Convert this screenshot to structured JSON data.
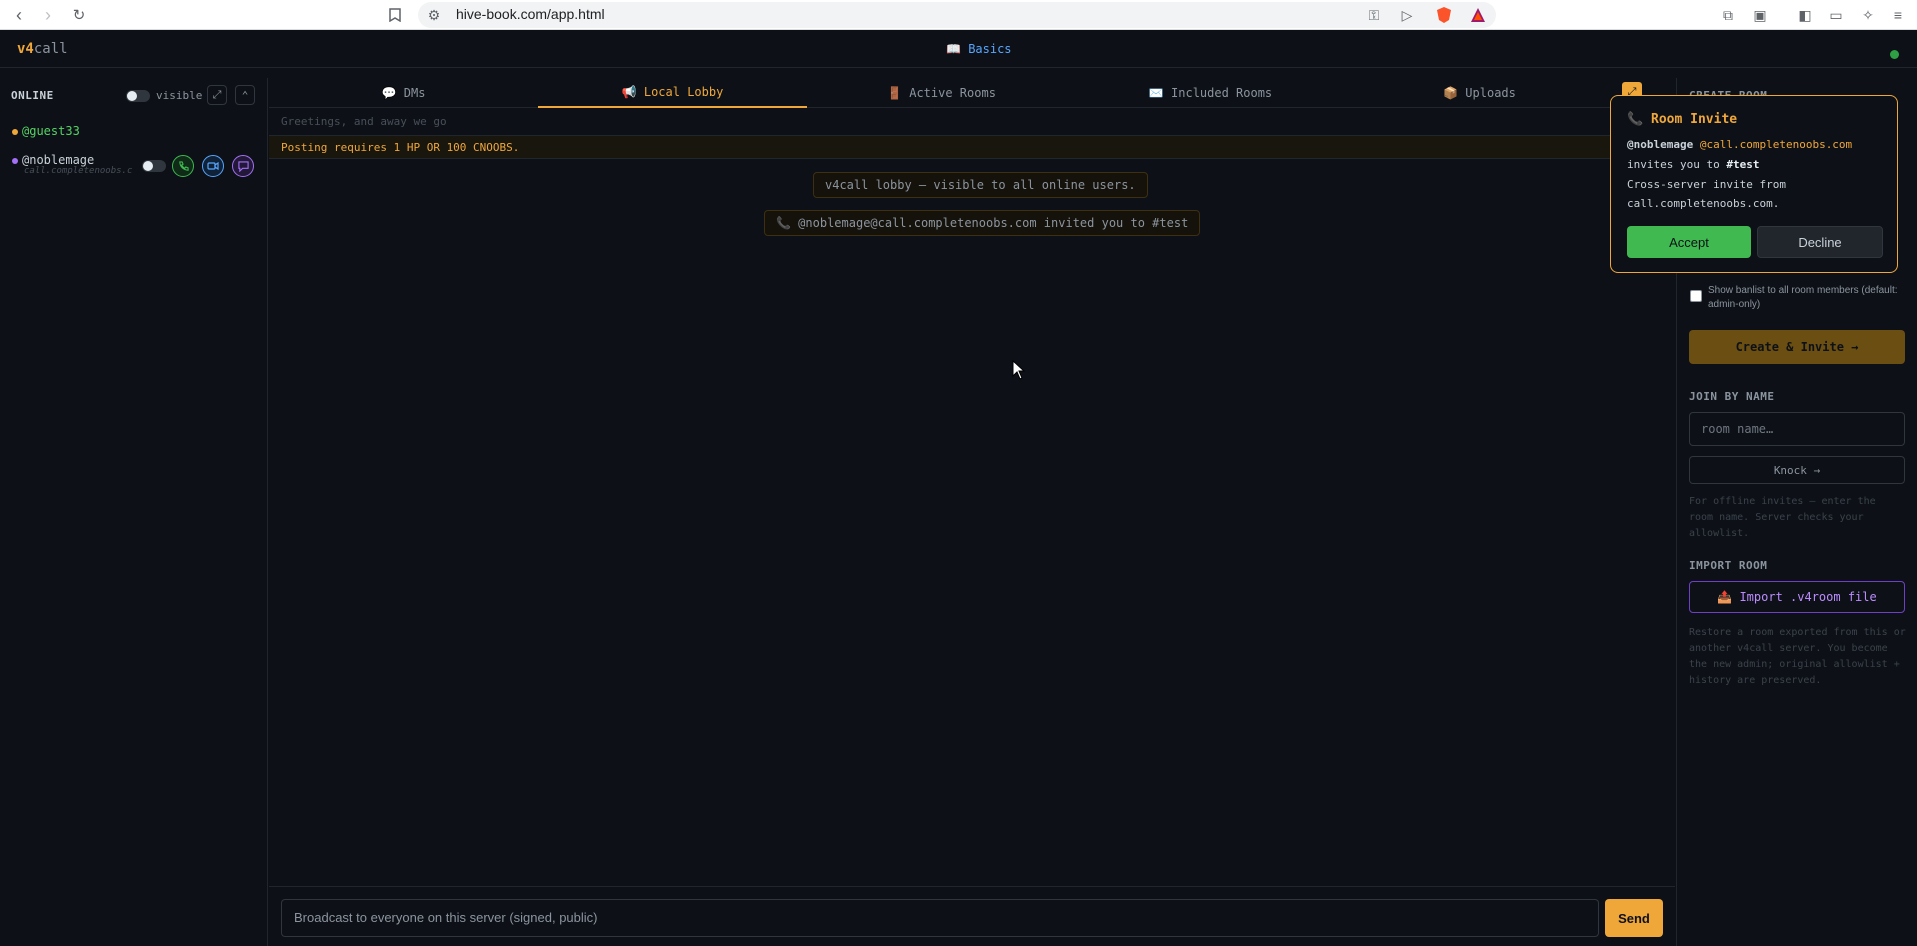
{
  "browser": {
    "url": "hive-book.com/app.html",
    "icons": [
      "back-icon",
      "forward-icon",
      "reload-icon",
      "bookmark-icon",
      "site-settings-icon",
      "key-icon",
      "send-icon",
      "brave-shield-icon",
      "brave-rewards-icon",
      "extensions-icon",
      "screenshot-icon",
      "sidebar-icon",
      "wallet-icon",
      "leo-ai-icon",
      "menu-icon"
    ]
  },
  "header": {
    "logo_a": "v4",
    "logo_b": "call",
    "center_link_icon": "📖",
    "center_link": "Basics"
  },
  "sidebar": {
    "title": "ONLINE",
    "visible_label": "visible",
    "users": [
      {
        "name": "@guest33",
        "color": "#56d364",
        "dot": "#f0a73a"
      },
      {
        "name": "@noblemage",
        "server": "call.completenoobs.com",
        "color": "#c9d1d9",
        "dot": "#a371f7"
      }
    ]
  },
  "tabs": [
    {
      "icon": "💬",
      "label": "DMs"
    },
    {
      "icon": "📢",
      "label": "Local Lobby",
      "active": true
    },
    {
      "icon": "🚪",
      "label": "Active Rooms"
    },
    {
      "icon": "✉️",
      "label": "Included Rooms"
    },
    {
      "icon": "📦",
      "label": "Uploads"
    }
  ],
  "lobby": {
    "motd": "Greetings, and away we go",
    "warning": "Posting requires 1 HP OR 100 CNOOBS.",
    "messages": [
      "v4call lobby — visible to all online users.",
      "📞 @noblemage@call.completenoobs.com invited you to #test"
    ]
  },
  "composer": {
    "placeholder": "Broadcast to everyone on this server (signed, public)",
    "send_label": "Send"
  },
  "right_panel": {
    "create_title": "CREATE ROOM",
    "banlist_label": "Show banlist to all room members (default: admin-only)",
    "create_button": "Create & Invite →",
    "join_title": "JOIN BY NAME",
    "join_placeholder": "room name…",
    "knock_button": "Knock →",
    "join_help": "For offline invites — enter the room name. Server checks your allowlist.",
    "import_title": "IMPORT ROOM",
    "import_button": "📤 Import .v4room file",
    "import_help": "Restore a room exported from this or another v4call server. You become the new admin; original allowlist + history are preserved."
  },
  "invite": {
    "title_icon": "📞",
    "title": "Room Invite",
    "from_user": "@noblemage",
    "from_server": "@call.completenoobs.com",
    "invites_text": "invites you to",
    "room": "#test",
    "cross_line1": "Cross-server invite from",
    "cross_line2": "call.completenoobs.com.",
    "accept": "Accept",
    "decline": "Decline"
  },
  "colors": {
    "accent": "#f0a73a",
    "bg": "#0d1117",
    "accept": "#3fb950",
    "online": "#2ea043"
  }
}
